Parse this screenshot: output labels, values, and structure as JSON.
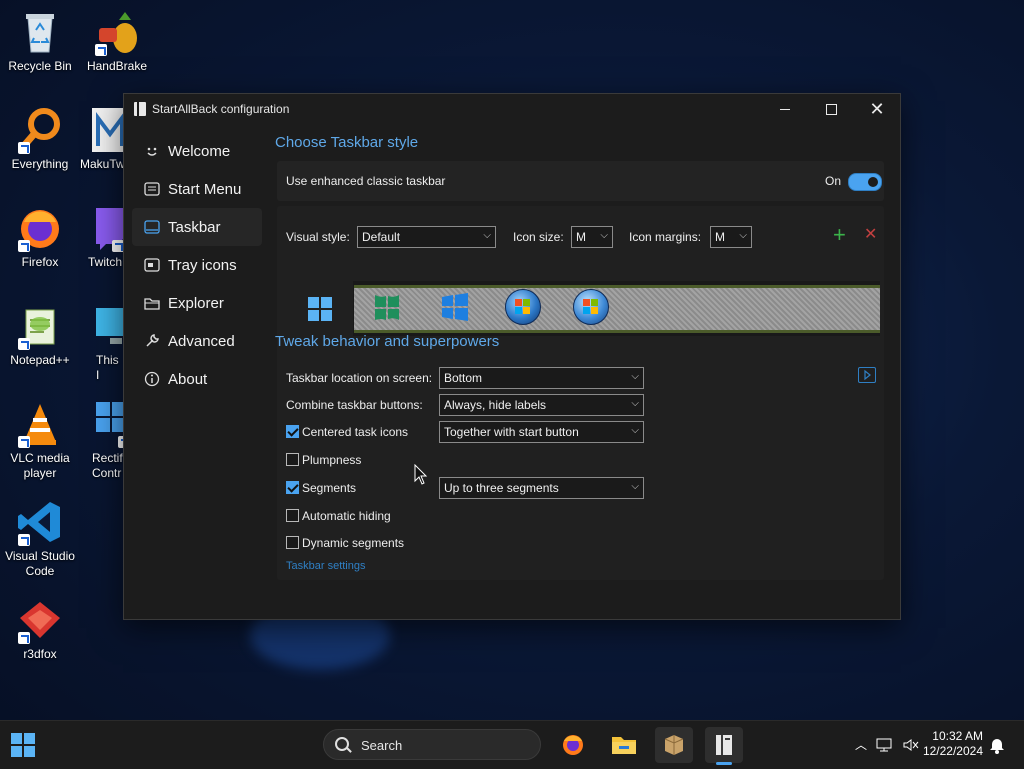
{
  "desktop": {
    "icons": [
      {
        "label": "Recycle Bin"
      },
      {
        "label": "HandBrake"
      },
      {
        "label": "Everything"
      },
      {
        "label": "MakuTw"
      },
      {
        "label": "Firefox"
      },
      {
        "label": "Twitch"
      },
      {
        "label": "Notepad++"
      },
      {
        "label": "This I"
      },
      {
        "label": "VLC media player"
      },
      {
        "label": "Rectif Contr"
      },
      {
        "label": "Visual Studio Code"
      },
      {
        "label": "r3dfox"
      }
    ]
  },
  "window": {
    "title": "StartAllBack configuration",
    "nav": [
      {
        "label": "Welcome",
        "icon": "smiley-icon"
      },
      {
        "label": "Start Menu",
        "icon": "start-menu-icon"
      },
      {
        "label": "Taskbar",
        "icon": "taskbar-icon",
        "active": true
      },
      {
        "label": "Tray icons",
        "icon": "tray-icon"
      },
      {
        "label": "Explorer",
        "icon": "folder-icon"
      },
      {
        "label": "Advanced",
        "icon": "wrench-icon"
      },
      {
        "label": "About",
        "icon": "info-icon"
      }
    ],
    "style_section": {
      "title": "Choose Taskbar style",
      "enhanced_label": "Use enhanced classic taskbar",
      "enhanced_state": "On",
      "visual_style_label": "Visual style:",
      "visual_style_value": "Default",
      "icon_size_label": "Icon size:",
      "icon_size_value": "M",
      "icon_margins_label": "Icon margins:",
      "icon_margins_value": "M",
      "add_symbol": "+",
      "remove_symbol": "✕"
    },
    "behavior_section": {
      "title": "Tweak behavior and superpowers",
      "location_label": "Taskbar location on screen:",
      "location_value": "Bottom",
      "combine_label": "Combine taskbar buttons:",
      "combine_value": "Always, hide labels",
      "centered_label": "Centered task icons",
      "centered_checked": true,
      "centered_value": "Together with start button",
      "plumpness_label": "Plumpness",
      "plumpness_checked": false,
      "segments_label": "Segments",
      "segments_checked": true,
      "segments_value": "Up to three segments",
      "autohide_label": "Automatic hiding",
      "autohide_checked": false,
      "dynamic_label": "Dynamic segments",
      "dynamic_checked": false,
      "settings_link": "Taskbar settings"
    }
  },
  "taskbar": {
    "search_placeholder": "Search",
    "time": "10:32 AM",
    "date": "12/22/2024"
  },
  "colors": {
    "accent": "#4aa3f0",
    "window_bg": "#1c1c1c",
    "section_title": "#5fa8e8"
  }
}
